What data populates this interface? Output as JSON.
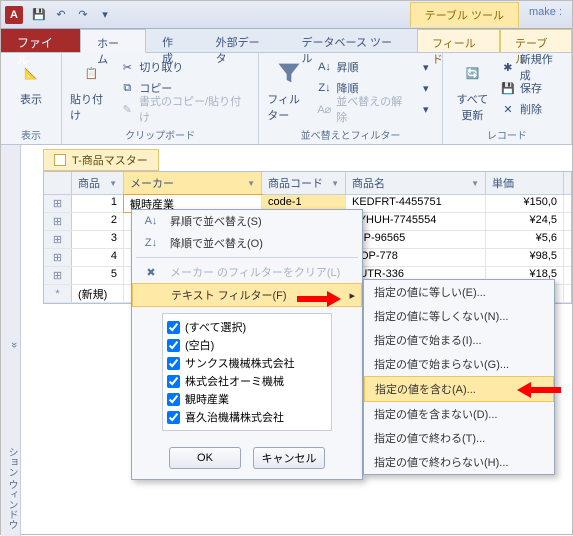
{
  "titlebar": {
    "ctx_title": "テーブル ツール",
    "win_title": "make :"
  },
  "tabs": {
    "file": "ファイル",
    "home": "ホーム",
    "create": "作成",
    "extdata": "外部データ",
    "dbtools": "データベース ツール",
    "field": "フィールド",
    "table": "テーブル"
  },
  "ribbon": {
    "view": "表示",
    "view_grp": "表示",
    "paste": "貼り付け",
    "cut": "切り取り",
    "copy": "コピー",
    "fmt_paste": "書式のコピー/貼り付け",
    "clipboard_grp": "クリップボード",
    "filter": "フィルター",
    "asc": "昇順",
    "desc": "降順",
    "clear_sort": "並べ替えの解除",
    "sort_grp": "並べ替えとフィルター",
    "refresh": "すべて\n更新",
    "new": "新規作成",
    "save": "保存",
    "delete": "削除",
    "records_grp": "レコード"
  },
  "table": {
    "tab_title": "T-商品マスター",
    "headers": {
      "id": "商品",
      "maker": "メーカー",
      "code": "商品コード",
      "name": "商品名",
      "price": "単価"
    },
    "rows": [
      {
        "id": "1",
        "maker": "観時産業",
        "code": "code-1",
        "name": "KEDFRT-4455751",
        "price": "¥150,0"
      },
      {
        "id": "2",
        "maker": "",
        "code": "",
        "name": "TYHUH-7745554",
        "price": "¥24,5"
      },
      {
        "id": "3",
        "maker": "",
        "code": "",
        "name": "IOP-96565",
        "price": "¥5,6"
      },
      {
        "id": "4",
        "maker": "",
        "code": "",
        "name": "DOP-778",
        "price": "¥98,5"
      },
      {
        "id": "5",
        "maker": "",
        "code": "",
        "name": "YUTR-336",
        "price": "¥18,5"
      }
    ],
    "new_row": "(新規)"
  },
  "popup": {
    "sort_asc": "昇順で並べ替え(S)",
    "sort_desc": "降順で並べ替え(O)",
    "clear_filter": "メーカー のフィルターをクリア(L)",
    "text_filter": "テキスト フィルター(F)",
    "checks": [
      "(すべて選択)",
      "(空白)",
      "サンクス機械株式会社",
      "株式会社オーミ機械",
      "観時産業",
      "喜久治機構株式会社"
    ],
    "ok": "OK",
    "cancel": "キャンセル"
  },
  "submenu": {
    "eq": "指定の値に等しい(E)...",
    "neq": "指定の値に等しくない(N)...",
    "begins": "指定の値で始まる(I)...",
    "nbegins": "指定の値で始まらない(G)...",
    "contains": "指定の値を含む(A)...",
    "ncontains": "指定の値を含まない(D)...",
    "ends": "指定の値で終わる(T)...",
    "nends": "指定の値で終わらない(H)..."
  },
  "sidebar_label": "ション ウィンドウ",
  "chart_data": null
}
